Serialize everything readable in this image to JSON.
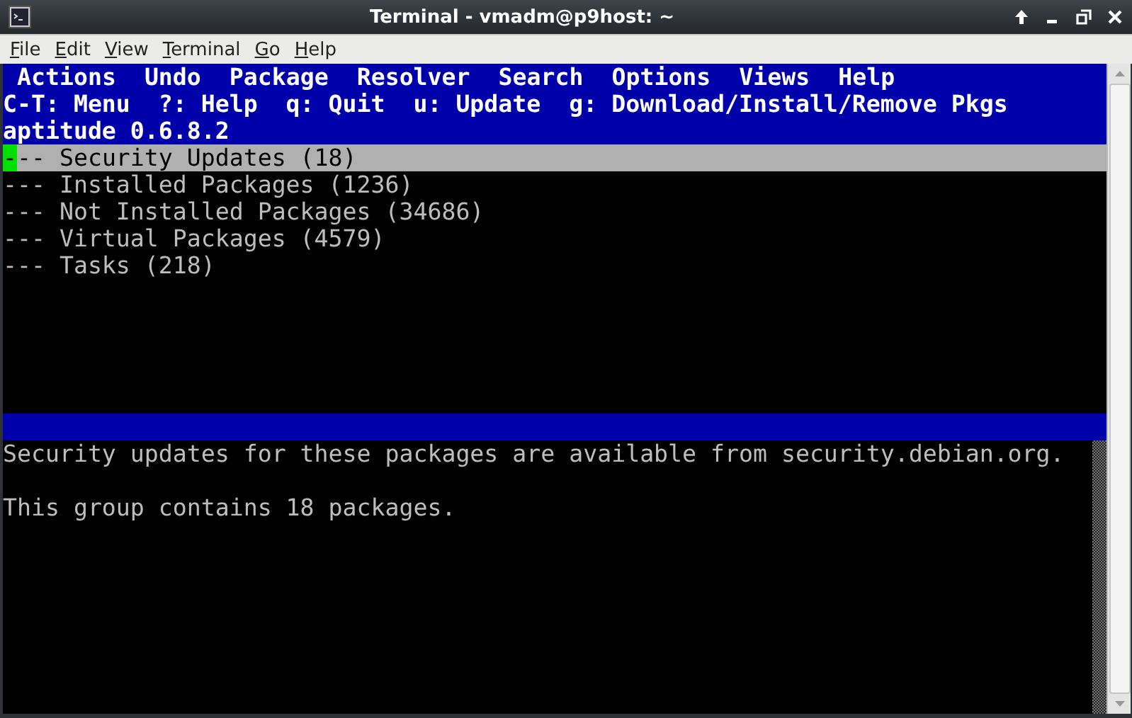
{
  "window": {
    "title": "Terminal - vmadm@p9host: ~"
  },
  "menubar": [
    "File",
    "Edit",
    "View",
    "Terminal",
    "Go",
    "Help"
  ],
  "aptitude": {
    "menu": [
      "Actions",
      "Undo",
      "Package",
      "Resolver",
      "Search",
      "Options",
      "Views",
      "Help"
    ],
    "hints": "C-T: Menu  ?: Help  q: Quit  u: Update  g: Download/Install/Remove Pkgs",
    "version": "aptitude 0.6.8.2",
    "tree": [
      {
        "label": "--- Security Updates (18)",
        "selected": true
      },
      {
        "label": "--- Installed Packages (1236)",
        "selected": false
      },
      {
        "label": "--- Not Installed Packages (34686)",
        "selected": false
      },
      {
        "label": "--- Virtual Packages (4579)",
        "selected": false
      },
      {
        "label": "--- Tasks (218)",
        "selected": false
      }
    ],
    "description": [
      "Security updates for these packages are available from security.debian.org.",
      "This group contains 18 packages."
    ]
  }
}
